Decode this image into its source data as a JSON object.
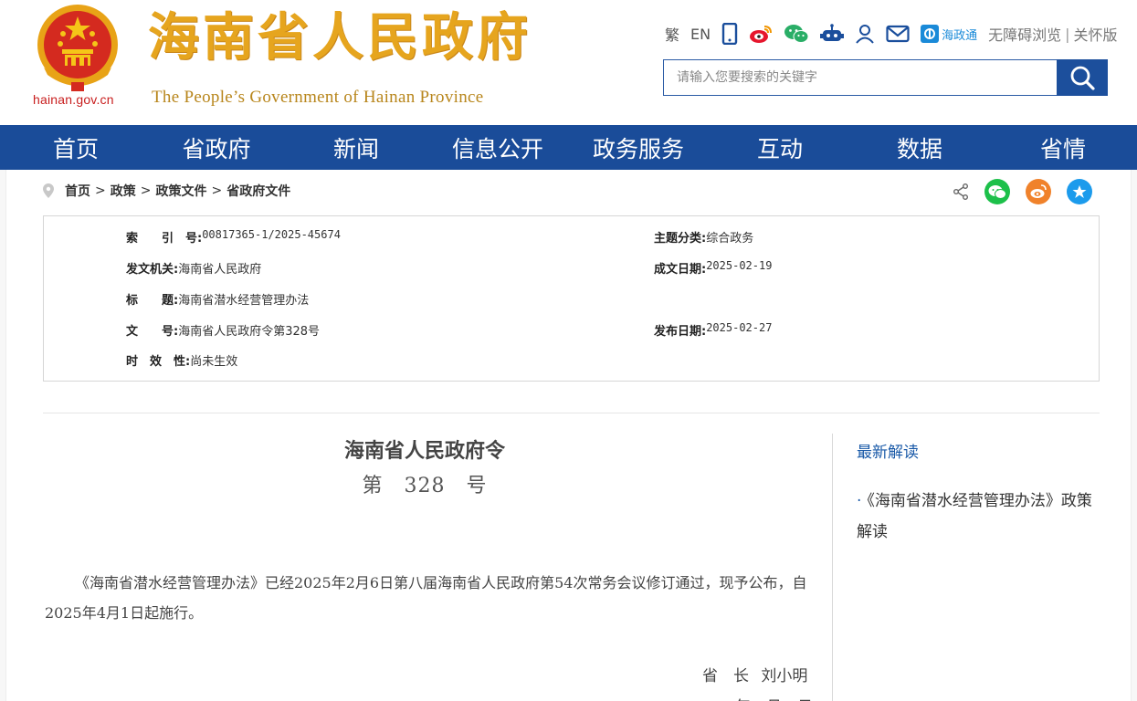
{
  "header": {
    "domain": "hainan.gov.cn",
    "title": "海南省人民政府",
    "subtitle": "The People’s Government  of Hainan Province",
    "tools": {
      "traditional": "繁",
      "english": "EN",
      "app_label": "海政通",
      "accessibility": "无障碍浏览",
      "separator": "|",
      "elderly": "关怀版"
    },
    "search": {
      "placeholder": "请输入您要搜索的关键字"
    },
    "colors": {
      "title": "#e6a51e",
      "nav": "#1a4c99",
      "accent": "#1c4f9c"
    }
  },
  "nav": {
    "items": [
      {
        "label": "首页"
      },
      {
        "label": "省政府"
      },
      {
        "label": "新闻"
      },
      {
        "label": "信息公开"
      },
      {
        "label": "政务服务"
      },
      {
        "label": "互动"
      },
      {
        "label": "数据"
      },
      {
        "label": "省情"
      }
    ]
  },
  "breadcrumb": {
    "items": [
      "首页",
      "政策",
      "政策文件",
      "省政府文件"
    ],
    "separator": ">"
  },
  "share": {
    "icons": [
      "share-icon",
      "wechat-icon",
      "weibo-icon",
      "favorite-icon"
    ]
  },
  "meta": {
    "index_key": "索　　引　号:",
    "index_val": "00817365-1/2025-45674",
    "topic_key": "主题分类:",
    "topic_val": "综合政务",
    "issuer_key": "发文机关:",
    "issuer_val": "海南省人民政府",
    "date_key": "成文日期:",
    "date_val": "2025-02-19",
    "title_key": "标　　题:",
    "title_val": "海南省潜水经营管理办法",
    "docno_key": "文　　号:",
    "docno_val": "海南省人民政府令第328号",
    "pub_key": "发布日期:",
    "pub_val": "2025-02-27",
    "valid_key": "时　效　性:",
    "valid_val": "尚未生效"
  },
  "document": {
    "title": "海南省人民政府令",
    "number": "第　328　号",
    "body": "《海南省潜水经营管理办法》已经2025年2月6日第八届海南省人民政府第54次常务会议修订通过，现予公布，自2025年4月1日起施行。",
    "sign_role": "省　长",
    "sign_name": "刘小明",
    "sign_date_partial": "年　月　日"
  },
  "sidebar": {
    "title": "最新解读",
    "items": [
      {
        "label": "《海南省潜水经营管理办法》政策解读"
      }
    ]
  }
}
